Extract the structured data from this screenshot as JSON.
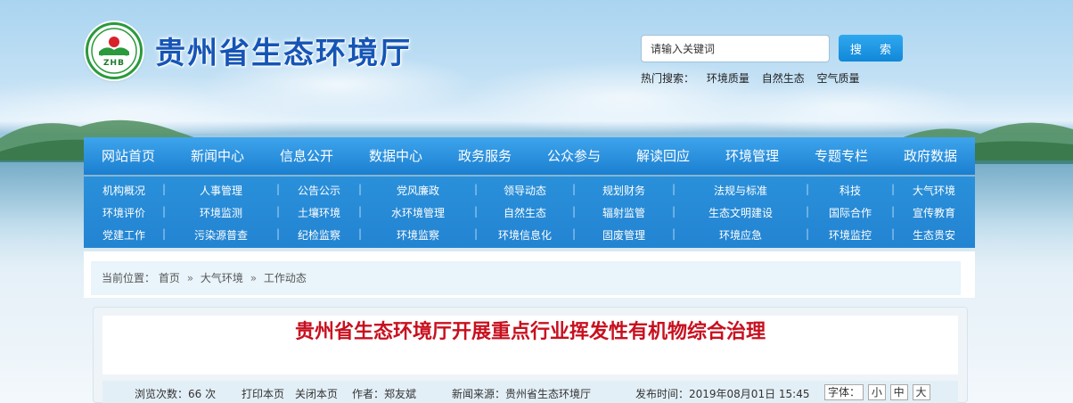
{
  "header": {
    "logo_text": "ZHB",
    "site_title": "贵州省生态环境厅",
    "search_placeholder": "请输入关键词",
    "search_button": "搜 索",
    "hot_label": "热门搜索：",
    "hot_terms": [
      "环境质量",
      "自然生态",
      "空气质量"
    ]
  },
  "main_nav": [
    "网站首页",
    "新闻中心",
    "信息公开",
    "数据中心",
    "政务服务",
    "公众参与",
    "解读回应",
    "环境管理",
    "专题专栏",
    "政府数据"
  ],
  "sub_nav": [
    [
      "机构概况",
      "人事管理",
      "公告公示",
      "党风廉政",
      "领导动态",
      "规划财务",
      "法规与标准",
      "科技",
      "大气环境"
    ],
    [
      "环境评价",
      "环境监测",
      "土壤环境",
      "水环境管理",
      "自然生态",
      "辐射监管",
      "生态文明建设",
      "国际合作",
      "宣传教育"
    ],
    [
      "党建工作",
      "污染源普查",
      "纪检监察",
      "环境监察",
      "环境信息化",
      "固废管理",
      "环境应急",
      "环境监控",
      "生态贵安"
    ]
  ],
  "breadcrumb": {
    "label": "当前位置：",
    "items": [
      "首页",
      "大气环境",
      "工作动态"
    ],
    "separator": "»"
  },
  "article": {
    "title": "贵州省生态环境厅开展重点行业挥发性有机物综合治理",
    "views": "浏览次数：66 次",
    "print": "打印本页",
    "close": "关闭本页",
    "author": "作者：郑友斌",
    "source": "新闻来源：贵州省生态环境厅",
    "published": "发布时间：2019年08月01日 15:45",
    "font_label": "字体：",
    "font_sizes": [
      "小",
      "中",
      "大"
    ]
  },
  "colors": {
    "nav_blue": "#1b7fd0",
    "title_blue": "#1555b5",
    "article_red": "#c8101f",
    "logo_green": "#2a9a3c"
  }
}
